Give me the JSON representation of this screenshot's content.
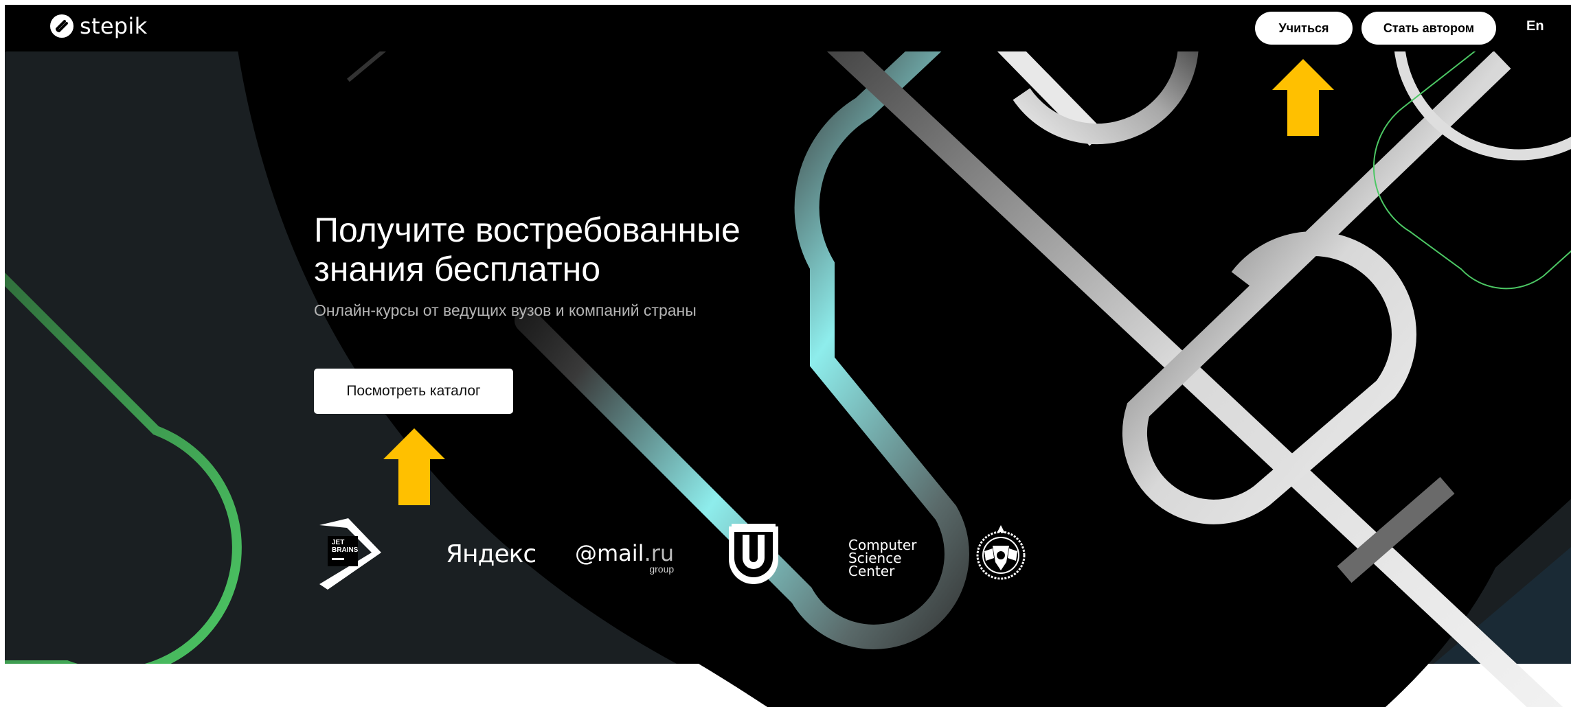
{
  "brand": {
    "name": "stepik",
    "icon": "stepik-logo-icon"
  },
  "nav": {
    "learn_label": "Учиться",
    "author_label": "Стать автором",
    "lang_label": "En"
  },
  "hero": {
    "title_line1": "Получите востребованные",
    "title_line2": "знания бесплатно",
    "subtitle": "Онлайн-курсы от ведущих вузов и компаний страны",
    "catalog_button": "Посмотреть каталог"
  },
  "partners": {
    "jetbrains": {
      "line1": "JET",
      "line2": "BRAINS"
    },
    "yandex": "Яндекс",
    "mailru": {
      "at": "@",
      "mail": "mail",
      "ru": ".ru",
      "group": "group"
    },
    "csc": {
      "line1": "Computer",
      "line2": "Science",
      "line3": "Center"
    },
    "urfu_icon": "urfu-shield-icon",
    "hse_icon": "hse-emblem-icon"
  },
  "annotations": {
    "arrow_color": "#FFC000"
  },
  "colors": {
    "background": "#000000",
    "accent_green": "#4CC764",
    "accent_teal": "#8EEDEC",
    "panel": "#1A1F22"
  }
}
